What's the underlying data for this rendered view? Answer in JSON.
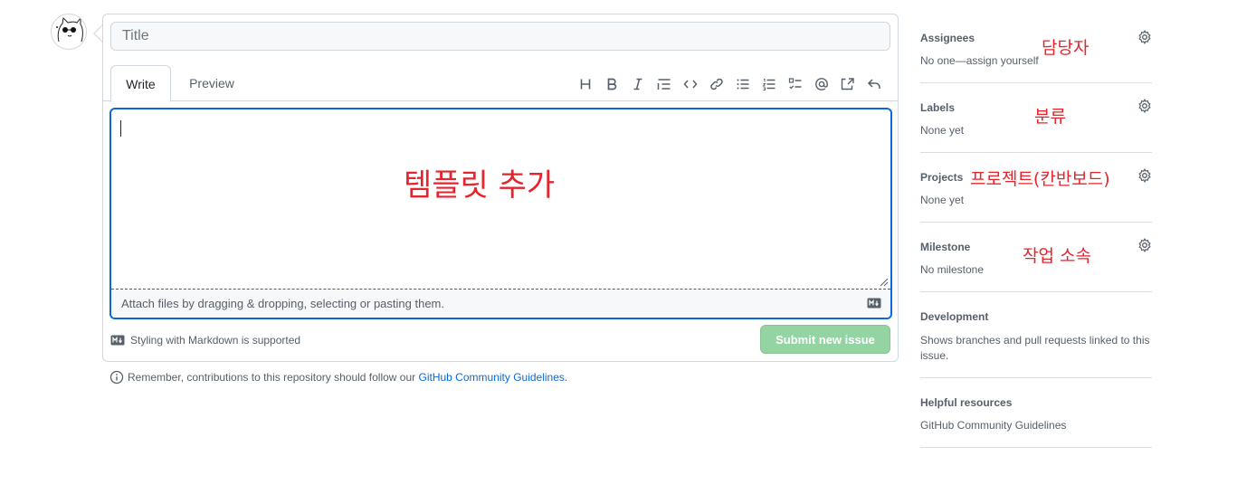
{
  "issue_form": {
    "title_placeholder": "Title",
    "tabs": [
      {
        "label": "Write",
        "active": true
      },
      {
        "label": "Preview",
        "active": false
      }
    ],
    "toolbar_icons": [
      "heading-icon",
      "bold-icon",
      "italic-icon",
      "quote-icon",
      "code-icon",
      "link-icon",
      "unordered-list-icon",
      "ordered-list-icon",
      "task-list-icon",
      "mention-icon",
      "reference-icon",
      "reply-icon"
    ],
    "body_annotation": "템플릿 추가",
    "attach_hint": "Attach files by dragging & dropping, selecting or pasting them.",
    "markdown_note": "Styling with Markdown is supported",
    "submit_label": "Submit new issue"
  },
  "guidelines_note": {
    "text": "Remember, contributions to this repository should follow our ",
    "link": "GitHub Community Guidelines",
    "suffix": "."
  },
  "sidebar": {
    "assignees": {
      "heading": "Assignees",
      "value": "No one—assign yourself",
      "annotation": "담당자"
    },
    "labels": {
      "heading": "Labels",
      "value": "None yet",
      "annotation": "분류"
    },
    "projects": {
      "heading": "Projects",
      "value": "None yet",
      "annotation": "프로젝트(칸반보드)"
    },
    "milestone": {
      "heading": "Milestone",
      "value": "No milestone",
      "annotation": "작업 소속"
    },
    "development": {
      "heading": "Development",
      "value": "Shows branches and pull requests linked to this issue."
    },
    "helpful": {
      "heading": "Helpful resources",
      "link": "GitHub Community Guidelines"
    }
  },
  "colors": {
    "accent": "#0969da",
    "annotation_red": "#e5242c",
    "submit_disabled": "#94d3a2",
    "border": "#d0d7de",
    "muted_text": "#57606a"
  }
}
